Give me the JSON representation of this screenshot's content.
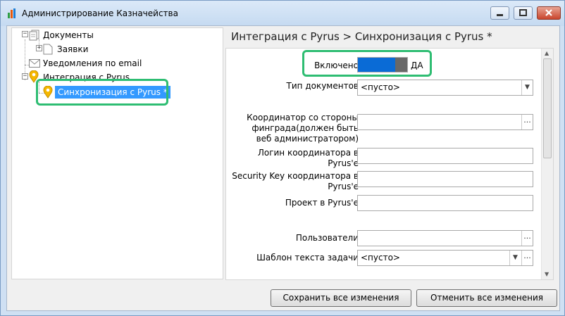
{
  "window": {
    "title": "Администрирование Казначейства"
  },
  "tree": {
    "items": [
      {
        "label": "Документы"
      },
      {
        "label": "Заявки"
      },
      {
        "label": "Уведомления по email"
      },
      {
        "label": "Интеграция с Pyrus"
      },
      {
        "label": "Синхронизация с Pyrus *"
      }
    ]
  },
  "panel": {
    "title": "Интеграция с Pyrus > Синхронизация с Pyrus *"
  },
  "form": {
    "enabled_label": "Включено",
    "enabled_value": "ДА",
    "doc_type_label": "Тип документов",
    "doc_type_value": "<пусто>",
    "coordinator_label": "Координатор со стороны финграда(должен быть веб администратором)",
    "login_label": "Логин координатора в Pyrus'е",
    "key_label": "Security Key координатора в Pyrus'е",
    "project_label": "Проект в Pyrus'е",
    "users_label": "Пользователи",
    "template_label": "Шаблон текста задачи",
    "template_value": "<пусто>",
    "ellipsis": "..."
  },
  "buttons": {
    "save": "Сохранить все изменения",
    "cancel": "Отменить все изменения"
  },
  "colors": {
    "highlight": "#2ebd72",
    "selection": "#3399ff",
    "toggle_on": "#0a6bd6"
  }
}
